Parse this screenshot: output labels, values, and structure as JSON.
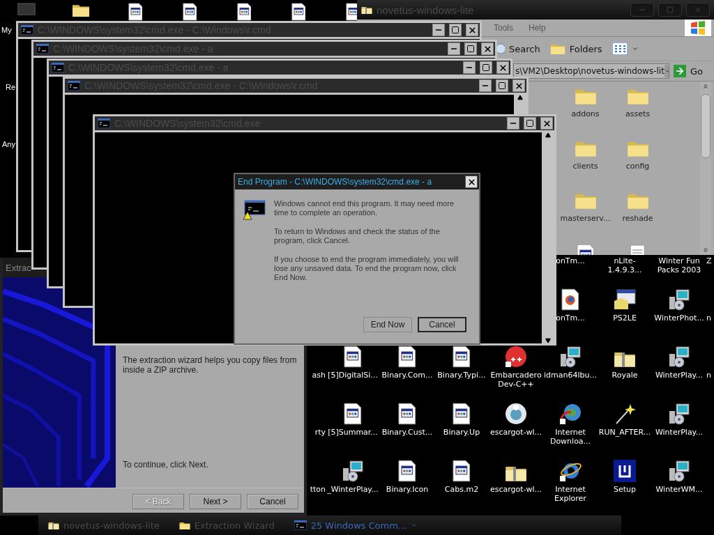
{
  "desktop": {
    "left_labels": [
      "My",
      "Re",
      "Any"
    ],
    "top_icons": [
      {
        "kind": "monitor"
      },
      {
        "kind": "folder"
      },
      {
        "kind": "document"
      },
      {
        "kind": "document"
      },
      {
        "kind": "document"
      },
      {
        "kind": "document"
      },
      {
        "kind": "document"
      }
    ],
    "icon_rows": [
      {
        "items": [
          {
            "label": "onTm...",
            "kind": "label"
          },
          {
            "label": "nLite-1.4.9.3...",
            "kind": "label"
          },
          {
            "label": "Winter Fun Packs 2003",
            "kind": "label"
          },
          {
            "label": "Z",
            "kind": "label"
          }
        ]
      },
      {
        "items": [
          {
            "label": "onTm...",
            "kind": "webdoc"
          },
          {
            "label": "PS2LE",
            "kind": "app"
          },
          {
            "label": "WinterPhot...",
            "kind": "installer"
          },
          {
            "label": "n",
            "kind": "label"
          }
        ]
      },
      {
        "items": [
          {
            "label": "ash",
            "kind": "label"
          },
          {
            "label": "[5]DigitalSi...",
            "kind": "document"
          },
          {
            "label": "Binary.Com...",
            "kind": "document"
          },
          {
            "label": "Binary.Typi...",
            "kind": "document"
          },
          {
            "label": "Embarcadero Dev-C++",
            "kind": "dev"
          },
          {
            "label": "idman64lbu...",
            "kind": "installer"
          },
          {
            "label": "Royale",
            "kind": "zip"
          },
          {
            "label": "WinterPlay...",
            "kind": "installer"
          },
          {
            "label": "n",
            "kind": "label"
          }
        ]
      },
      {
        "items": [
          {
            "label": "rty",
            "kind": "label"
          },
          {
            "label": "[5]Summar...",
            "kind": "document"
          },
          {
            "label": "Binary.Cust...",
            "kind": "document"
          },
          {
            "label": "Binary.Up",
            "kind": "document"
          },
          {
            "label": "escargot-wl...",
            "kind": "disc"
          },
          {
            "label": "Internet Downloa...",
            "kind": "globe"
          },
          {
            "label": "RUN_AFTER...",
            "kind": "wand"
          },
          {
            "label": "WinterPlay...",
            "kind": "installer"
          }
        ]
      },
      {
        "items": [
          {
            "label": "tton",
            "kind": "label"
          },
          {
            "label": "_WinterPlay...",
            "kind": "installer"
          },
          {
            "label": "Binary.Icon",
            "kind": "document"
          },
          {
            "label": "Cabs.m2",
            "kind": "document"
          },
          {
            "label": "escargot-wl...",
            "kind": "zip"
          },
          {
            "label": "Internet Explorer",
            "kind": "ie"
          },
          {
            "label": "Setup",
            "kind": "setup"
          },
          {
            "label": "WinterWM...",
            "kind": "installer"
          }
        ]
      }
    ]
  },
  "explorer": {
    "title": "novetus-windows-lite",
    "active": false,
    "menu": [
      "Tools",
      "Help"
    ],
    "toolbar": [
      "Search",
      "Folders"
    ],
    "address": "s\\VM2\\Desktop\\novetus-windows-lit",
    "go": "Go",
    "items": [
      {
        "label": "addons",
        "kind": "folder"
      },
      {
        "label": "assets",
        "kind": "folder"
      },
      {
        "label": "clients",
        "kind": "folder"
      },
      {
        "label": "config",
        "kind": "folder"
      },
      {
        "label": "masterserv...",
        "kind": "folder"
      },
      {
        "label": "reshade",
        "kind": "folder"
      },
      {
        "kind": "document"
      },
      {
        "kind": "notepad"
      }
    ]
  },
  "wizard": {
    "title": "Extrac",
    "active": false,
    "intro": "The extraction wizard helps you copy files from inside a ZIP archive.",
    "hint": "To continue, click Next.",
    "buttons": [
      {
        "label": "< Back",
        "disabled": true
      },
      {
        "label": "Next >",
        "disabled": false
      },
      {
        "label": "Cancel",
        "disabled": false
      }
    ]
  },
  "consoles": [
    {
      "title": "C:\\WINDOWS\\system32\\cmd.exe - C:\\Windows\\r.cmd",
      "active": false
    },
    {
      "title": "C:\\WINDOWS\\system32\\cmd.exe - a",
      "active": false
    },
    {
      "title": "C:\\WINDOWS\\system32\\cmd.exe - a",
      "active": false
    },
    {
      "title": "C:\\WINDOWS\\system32\\cmd.exe - C:\\Windows\\r.cmd",
      "active": false
    },
    {
      "title": "C:\\WINDOWS\\system32\\cmd.exe",
      "active": false
    }
  ],
  "dialog": {
    "title": "End Program - C:\\WINDOWS\\system32\\cmd.exe - a",
    "active": true,
    "paragraphs": [
      "Windows cannot end this program. It may need more time to complete an operation.",
      "To return to Windows and check the status of the program, click Cancel.",
      "If you choose to end the program immediately, you will lose any unsaved data. To end the program now, click End Now."
    ],
    "buttons": [
      {
        "label": "End Now",
        "default": false
      },
      {
        "label": "Cancel",
        "default": true
      }
    ]
  },
  "taskbar": [
    {
      "label": "novetus-windows-lite",
      "kind": "zip"
    },
    {
      "label": "Extraction Wizard",
      "kind": "folder"
    },
    {
      "label": "25 Windows Comm...",
      "kind": "console"
    }
  ]
}
